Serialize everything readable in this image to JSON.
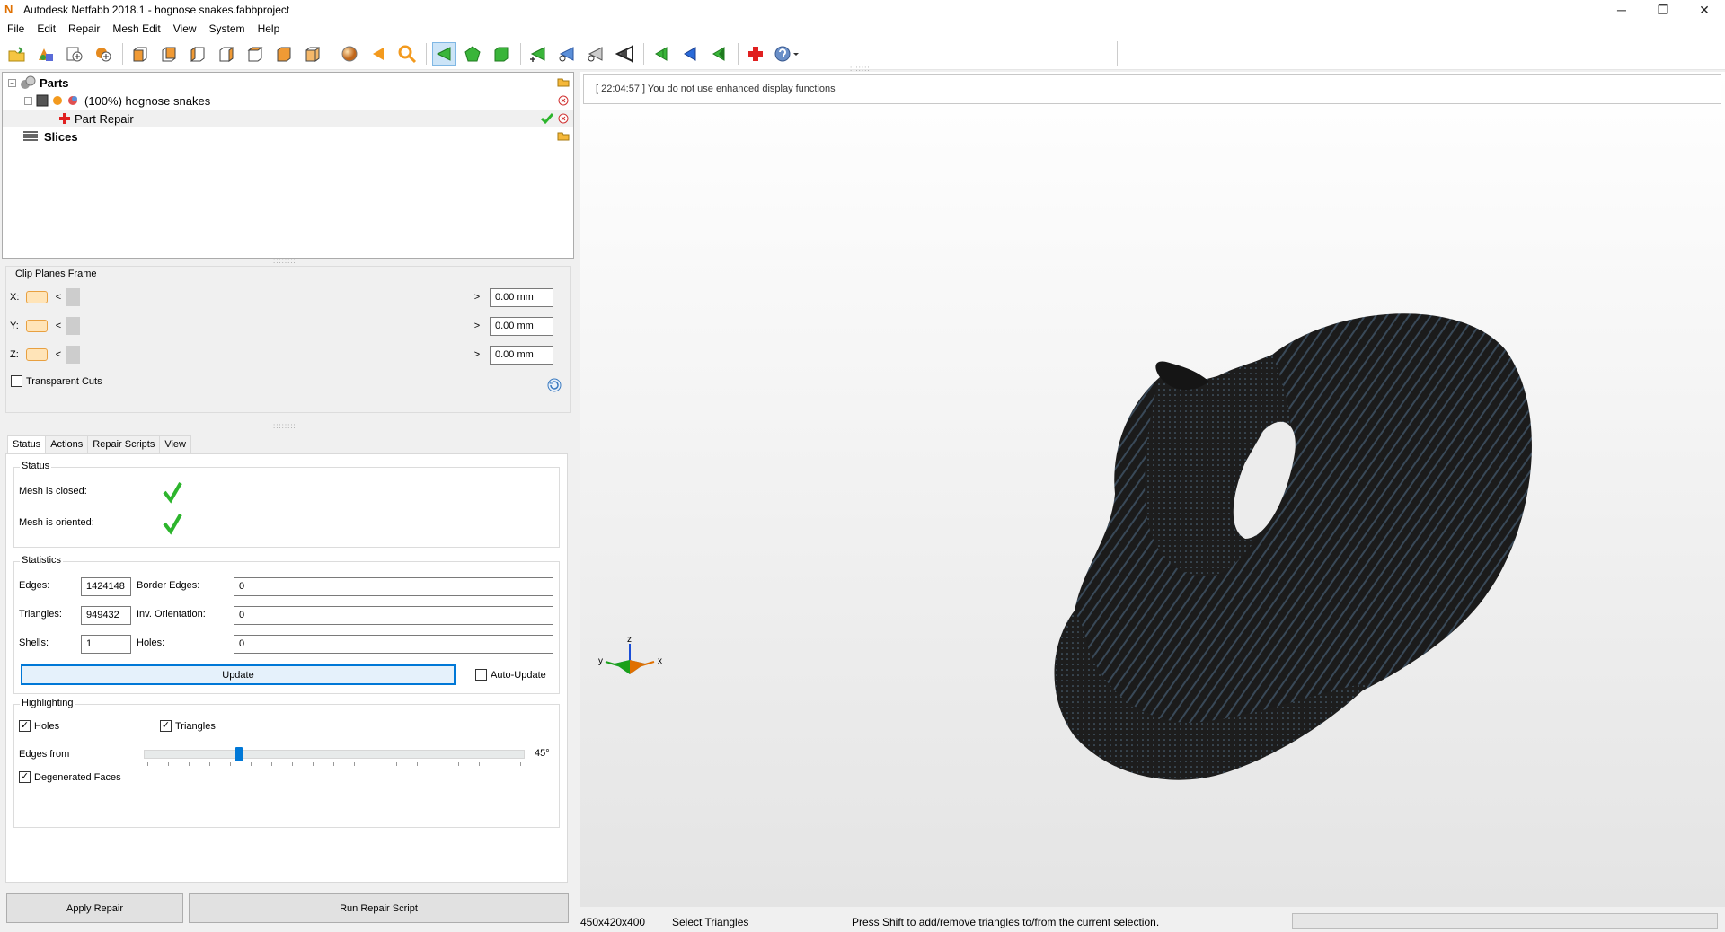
{
  "window": {
    "title": "Autodesk Netfabb 2018.1 - hognose snakes.fabbproject",
    "logo_letter": "N",
    "controls": {
      "minimize": "─",
      "restore": "❐",
      "close": "✕"
    }
  },
  "menu": [
    "File",
    "Edit",
    "Repair",
    "Mesh Edit",
    "View",
    "System",
    "Help"
  ],
  "toolbar": {
    "icons": [
      "open-project-icon",
      "add-part-icon",
      "new-part-icon",
      "import-icon",
      "view-front-icon",
      "view-back-icon",
      "view-left-icon",
      "view-right-icon",
      "view-top-icon",
      "view-bottom-icon",
      "view-iso-icon",
      "sphere-icon",
      "previous-icon",
      "zoom-icon",
      "select-triangles-icon",
      "select-surface-icon",
      "select-shell-icon",
      "add-triangle-icon",
      "move-point-icon",
      "triangulate-icon",
      "cut-icon",
      "undo-icon",
      "redo-icon",
      "repair-cross-icon",
      "help-icon"
    ]
  },
  "tree": {
    "parts_label": "Parts",
    "part_label": "(100%) hognose snakes",
    "repair_label": "Part Repair",
    "slices_label": "Slices"
  },
  "clip": {
    "title": "Clip Planes Frame",
    "rows": [
      {
        "axis": "X:",
        "value": "0.00 mm"
      },
      {
        "axis": "Y:",
        "value": "0.00 mm"
      },
      {
        "axis": "Z:",
        "value": "0.00 mm"
      }
    ],
    "left_arrow": "<",
    "right_arrow": ">",
    "transparent_label": "Transparent Cuts"
  },
  "tabs": [
    "Status",
    "Actions",
    "Repair Scripts",
    "View"
  ],
  "status": {
    "group_title": "Status",
    "closed_label": "Mesh is closed:",
    "oriented_label": "Mesh is oriented:"
  },
  "stats": {
    "group_title": "Statistics",
    "edges_label": "Edges:",
    "edges_value": "1424148",
    "border_label": "Border Edges:",
    "border_value": "0",
    "triangles_label": "Triangles:",
    "triangles_value": "949432",
    "inv_label": "Inv. Orientation:",
    "inv_value": "0",
    "shells_label": "Shells:",
    "shells_value": "1",
    "holes_label": "Holes:",
    "holes_value": "0",
    "update_label": "Update",
    "auto_update_label": "Auto-Update"
  },
  "highlight": {
    "group_title": "Highlighting",
    "holes_label": "Holes",
    "triangles_label": "Triangles",
    "edges_label": "Edges from",
    "edges_value": "45°",
    "edges_slider_fraction": 0.25,
    "degenerated_label": "Degenerated Faces"
  },
  "buttons": {
    "apply": "Apply Repair",
    "run_script": "Run Repair Script"
  },
  "viewport": {
    "log": "[ 22:04:57 ] You do not use enhanced display functions",
    "axis_z": "z",
    "axis_y": "y",
    "axis_x": "x"
  },
  "statusbar": {
    "size": "450x420x400",
    "mode": "Select Triangles",
    "hint": "Press Shift to add/remove triangles to/from the current selection."
  },
  "colors": {
    "accent": "#0078d7",
    "check_green": "#2db52d",
    "mesh_dark": "#1e1e1e",
    "mesh_highlight": "#7fb0d8"
  }
}
